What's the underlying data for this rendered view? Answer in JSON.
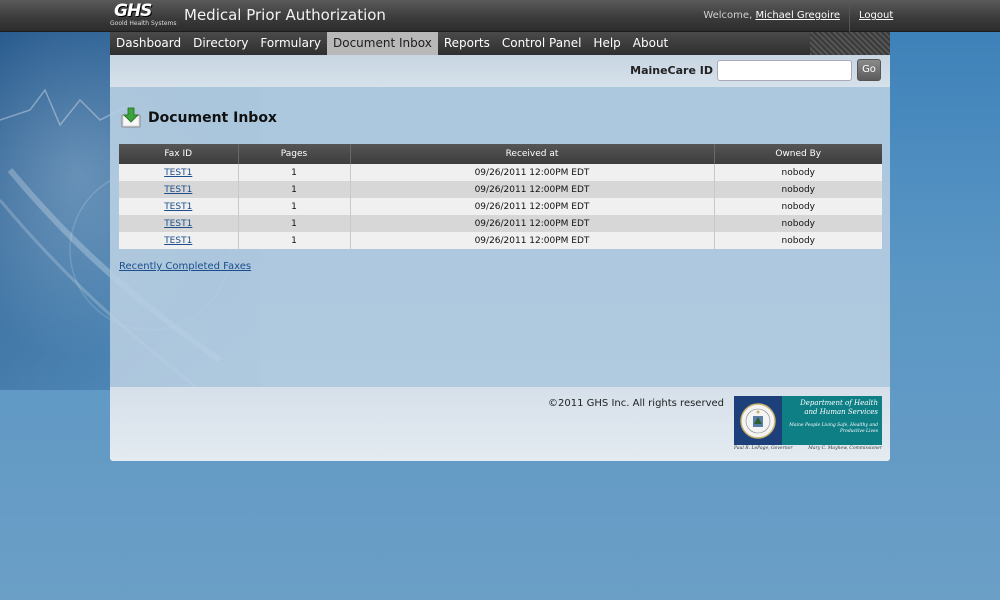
{
  "header": {
    "logo_text": "GHS",
    "logo_subtitle": "Goold Health Systems",
    "app_title": "Medical Prior Authorization",
    "welcome_prefix": "Welcome,",
    "user_name": "Michael Gregoire",
    "logout_label": "Logout"
  },
  "nav": {
    "items": [
      "Dashboard",
      "Directory",
      "Formulary",
      "Document Inbox",
      "Reports",
      "Control Panel",
      "Help",
      "About"
    ],
    "active": "Document Inbox"
  },
  "search": {
    "label": "MaineCare ID",
    "value": "",
    "go_label": "Go"
  },
  "main": {
    "page_title": "Document Inbox",
    "table": {
      "columns": [
        "Fax ID",
        "Pages",
        "Received at",
        "Owned By"
      ],
      "rows": [
        [
          "TEST1",
          "1",
          "09/26/2011 12:00PM EDT",
          "nobody"
        ],
        [
          "TEST1",
          "1",
          "09/26/2011 12:00PM EDT",
          "nobody"
        ],
        [
          "TEST1",
          "1",
          "09/26/2011 12:00PM EDT",
          "nobody"
        ],
        [
          "TEST1",
          "1",
          "09/26/2011 12:00PM EDT",
          "nobody"
        ],
        [
          "TEST1",
          "1",
          "09/26/2011 12:00PM EDT",
          "nobody"
        ]
      ]
    },
    "recent_link": "Recently Completed Faxes"
  },
  "footer": {
    "copyright": "©2011 GHS Inc. All rights reserved",
    "dhhs_title": "Department of Health and Human Services",
    "dhhs_tagline": "Maine People Living Safe, Healthy and Productive Lives",
    "governor": "Paul R. LePage, Governor",
    "commissioner": "Mary C. Mayhew, Commissioner"
  },
  "colors": {
    "background": "#4f8fc2",
    "header": "#3a3a3a",
    "nav_active": "#b8b8b8",
    "link": "#1b4e8a",
    "dhhs_teal": "#0f7f86"
  }
}
